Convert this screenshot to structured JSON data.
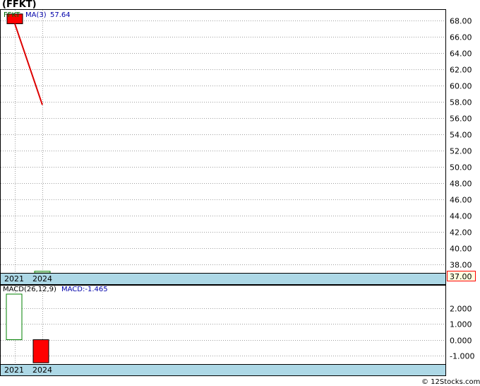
{
  "title": "(FFKT)",
  "watermark": "© 12Stocks.com",
  "colors": {
    "frame": "#000000",
    "grid": "#a0a0a0",
    "axis_band": "#add8e6",
    "down_fill": "#ff0000",
    "up_stroke": "#008000",
    "ma_line": "#dd0000",
    "ma_text": "#0000aa",
    "last_label_border": "#ff0000",
    "last_label_bg": "#ffffe0"
  },
  "chart_data": [
    {
      "type": "candlestick",
      "name": "price",
      "legend": {
        "symbol": "FFKT",
        "ma_label": "MA(3)",
        "ma_value": "57.64"
      },
      "x_labels": [
        "2021",
        "2024"
      ],
      "y_ticks": [
        "68.00",
        "66.00",
        "64.00",
        "62.00",
        "60.00",
        "58.00",
        "56.00",
        "54.00",
        "52.00",
        "50.00",
        "48.00",
        "46.00",
        "44.00",
        "42.00",
        "40.00",
        "38.00"
      ],
      "last_price_label": "37.00",
      "ylim": [
        37,
        69.3
      ],
      "candles": [
        {
          "x": "2021",
          "open": 68.8,
          "close": 67.6,
          "high": 68.8,
          "low": 67.6,
          "direction": "down"
        },
        {
          "x": "2024",
          "open": 37.0,
          "close": 37.2,
          "high": 37.2,
          "low": 37.0,
          "direction": "up"
        }
      ],
      "ma_points": [
        {
          "x": "2021",
          "y": 67.6
        },
        {
          "x": "2024",
          "y": 57.64
        }
      ]
    },
    {
      "type": "bar",
      "name": "macd",
      "legend": {
        "params_label": "MACD(26,12,9)",
        "value_label": "MACD:-1.465"
      },
      "x_labels": [
        "2021",
        "2024"
      ],
      "y_ticks": [
        "2.000",
        "1.000",
        "0.000",
        "-1.000"
      ],
      "ylim": [
        -1.55,
        2.9
      ],
      "bars": [
        {
          "x": "2021",
          "value": 2.9,
          "direction": "up"
        },
        {
          "x": "2024",
          "value": -1.465,
          "direction": "down"
        }
      ]
    }
  ]
}
